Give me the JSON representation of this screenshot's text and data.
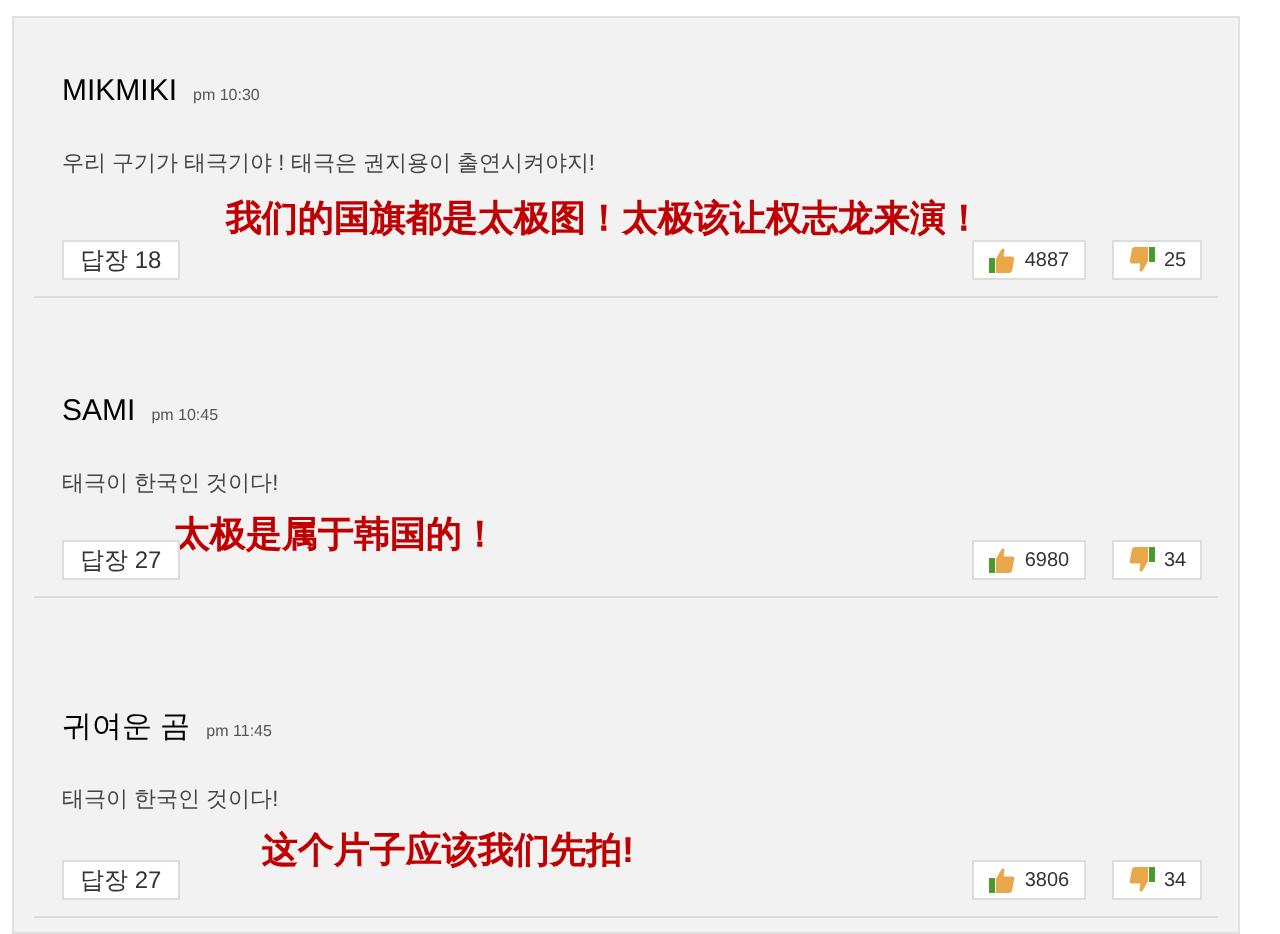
{
  "comments": [
    {
      "author": "MIKMIKI",
      "time": "pm 10:30",
      "text": "우리 구기가 태극기야 ! 태극은 권지용이 출연시켜야지!",
      "overlay": "我们的国旗都是太极图！太极该让权志龙来演！",
      "reply_button": "답장 18",
      "likes": "4887",
      "dislikes": "25"
    },
    {
      "author": "SAMI",
      "time": "pm 10:45",
      "text": "태극이 한국인 것이다!",
      "overlay": "太极是属于韩国的！",
      "reply_button": "답장 27",
      "likes": "6980",
      "dislikes": "34"
    },
    {
      "author": "귀여운 곰",
      "time": "pm 11:45",
      "text": "태극이 한국인 것이다!",
      "overlay": "这个片子应该我们先拍!",
      "reply_button": "답장 27",
      "likes": "3806",
      "dislikes": "34"
    }
  ]
}
